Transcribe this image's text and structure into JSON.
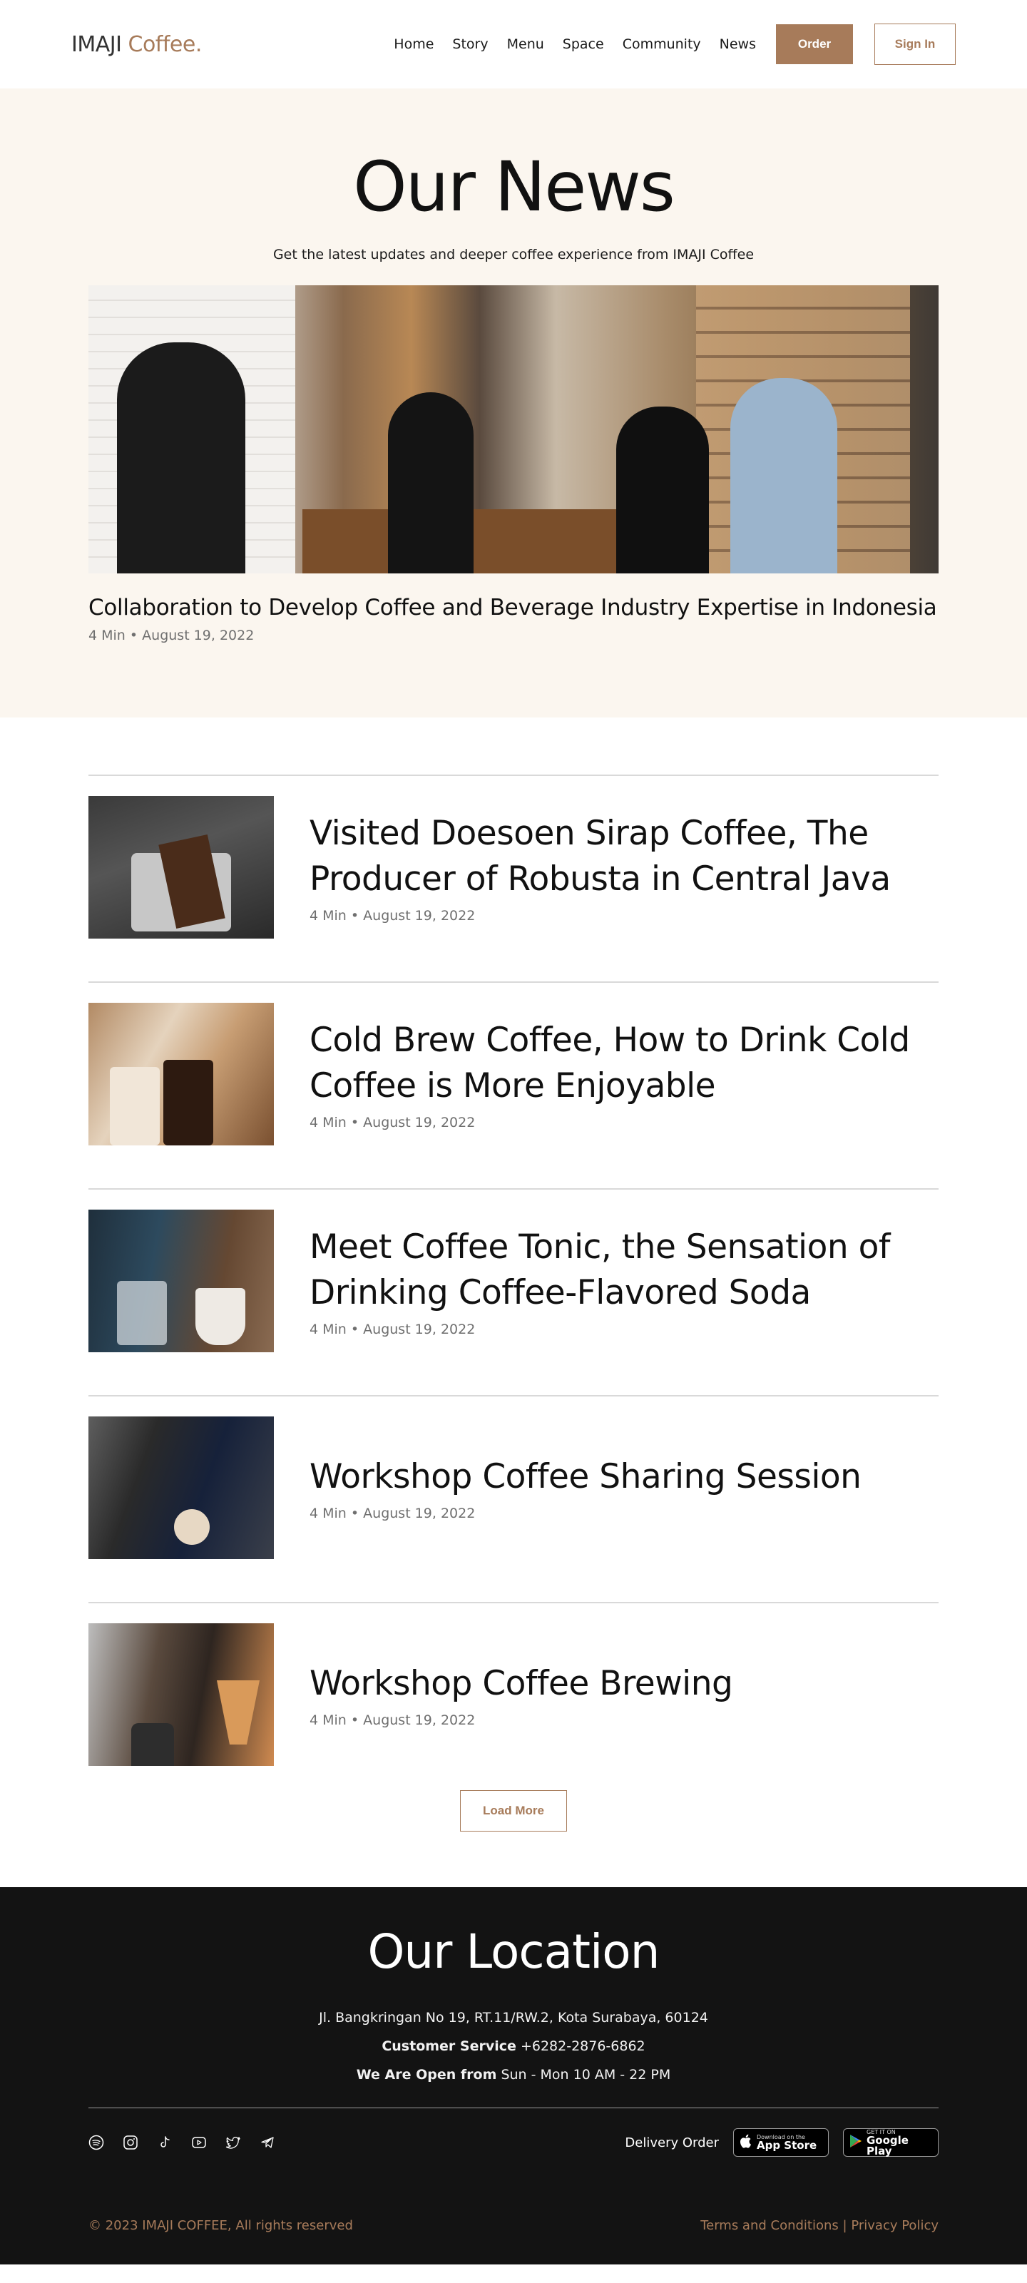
{
  "header": {
    "logo_main": "IMAJI",
    "logo_accent": "Coffee.",
    "nav": [
      "Home",
      "Story",
      "Menu",
      "Space",
      "Community",
      "News"
    ],
    "order_label": "Order",
    "signin_label": "Sign In"
  },
  "hero": {
    "title": "Our News",
    "subtitle": "Get the latest updates and deeper coffee experience from IMAJI Coffee",
    "featured": {
      "title": "Collaboration to Develop Coffee and Beverage Industry Expertise in Indonesia",
      "read_time": "4 Min",
      "date": "August 19, 2022"
    }
  },
  "articles": [
    {
      "title_line1": "Visited Doesoen Sirap Coffee, The",
      "title_line2": "Producer of Robusta in Central Java",
      "read_time": "4 Min",
      "date": "August 19, 2022"
    },
    {
      "title_line1": "Cold Brew Coffee, How to Drink Cold",
      "title_line2": "Coffee is More Enjoyable",
      "read_time": "4 Min",
      "date": "August 19, 2022"
    },
    {
      "title_line1": "Meet Coffee Tonic, the Sensation of",
      "title_line2": "Drinking Coffee-Flavored Soda",
      "read_time": "4 Min",
      "date": "August 19, 2022"
    },
    {
      "title_line1": "Workshop Coffee Sharing Session",
      "title_line2": "",
      "read_time": "4 Min",
      "date": "August 19, 2022"
    },
    {
      "title_line1": "Workshop Coffee Brewing",
      "title_line2": "",
      "read_time": "4 Min",
      "date": "August 19, 2022"
    }
  ],
  "meta_separator": "•",
  "load_more_label": "Load More",
  "footer": {
    "title": "Our Location",
    "address": "Jl. Bangkringan No 19, RT.11/RW.2, Kota Surabaya, 60124",
    "service_label": "Customer Service",
    "service_value": "+6282-2876-6862",
    "hours_label": "We Are Open from",
    "hours_value": "Sun - Mon 10 AM - 22 PM",
    "socials": [
      "spotify-icon",
      "instagram-icon",
      "tiktok-icon",
      "youtube-icon",
      "twitter-icon",
      "telegram-icon"
    ],
    "delivery_label": "Delivery Order",
    "appstore_small": "Download on the",
    "appstore_big": "App Store",
    "gplay_small": "GET IT ON",
    "gplay_big": "Google Play",
    "copyright": "© 2023 IMAJI COFFEE, All rights reserved",
    "terms": "Terms and Conditions",
    "link_separator": "|",
    "privacy": "Privacy Policy"
  },
  "colors": {
    "accent": "#a77b5a",
    "hero_bg": "#fbf6ef",
    "footer_bg": "#131313"
  }
}
